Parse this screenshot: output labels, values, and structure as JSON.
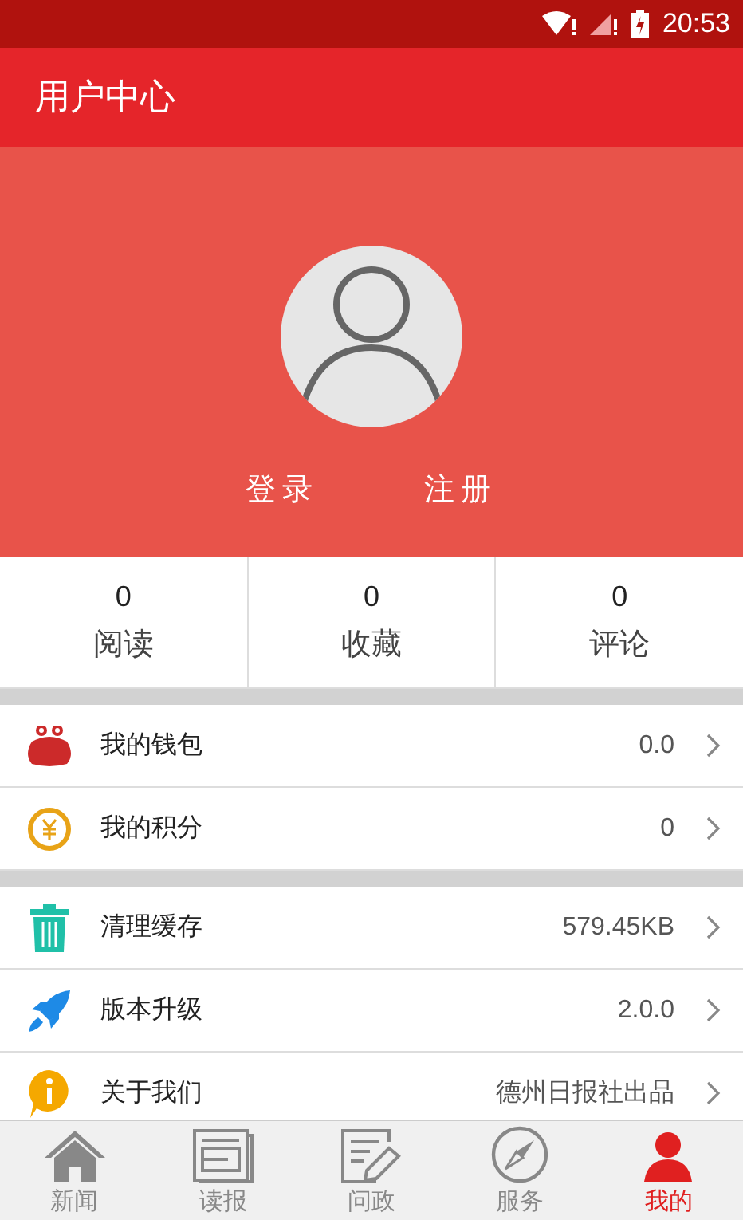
{
  "status_bar": {
    "time": "20:53"
  },
  "header": {
    "title": "用户中心"
  },
  "profile": {
    "login": "登录",
    "register": "注册"
  },
  "stats": [
    {
      "value": "0",
      "label": "阅读"
    },
    {
      "value": "0",
      "label": "收藏"
    },
    {
      "value": "0",
      "label": "评论"
    }
  ],
  "menu_groups": [
    [
      {
        "kind": "wallet",
        "label": "我的钱包",
        "value": "0.0"
      },
      {
        "kind": "points",
        "label": "我的积分",
        "value": "0"
      }
    ],
    [
      {
        "kind": "cache",
        "label": "清理缓存",
        "value": "579.45KB"
      },
      {
        "kind": "version",
        "label": "版本升级",
        "value": "2.0.0"
      },
      {
        "kind": "about",
        "label": "关于我们",
        "value": "德州日报社出品"
      }
    ]
  ],
  "tabs": [
    {
      "kind": "news",
      "label": "新闻",
      "selected": false
    },
    {
      "kind": "paper",
      "label": "读报",
      "selected": false
    },
    {
      "kind": "politics",
      "label": "问政",
      "selected": false
    },
    {
      "kind": "service",
      "label": "服务",
      "selected": false
    },
    {
      "kind": "mine",
      "label": "我的",
      "selected": true
    }
  ]
}
